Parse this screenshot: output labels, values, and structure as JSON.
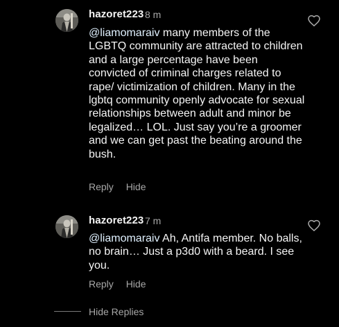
{
  "comments": [
    {
      "username": "hazoret223",
      "time": "8 m",
      "mention": "@liamomaraiv",
      "text": " many members of the LGBTQ community are attracted to children and a large percentage have been convicted of criminal charges related to rape/ victimization of children. Many in the lgbtq community openly advocate for sexual relationships between adult and minor be legalized… LOL. Just say you’re a groomer and we can get past the beating around the bush.",
      "reply_label": "Reply",
      "hide_label": "Hide",
      "avatar_icon": "user-avatar-icon",
      "like_icon": "heart-outline-icon"
    },
    {
      "username": "hazoret223",
      "time": "7 m",
      "mention": "@liamomaraiv",
      "text": " Ah, Antifa member. No balls, no brain… Just a p3d0 with a beard. I see you.",
      "reply_label": "Reply",
      "hide_label": "Hide",
      "avatar_icon": "user-avatar-icon",
      "like_icon": "heart-outline-icon"
    }
  ],
  "hide_replies_label": "Hide Replies",
  "colors": {
    "background": "#000000",
    "primary_text": "#f5f5f5",
    "secondary_text": "#a8a8a8",
    "mention": "#e0f1ff"
  }
}
